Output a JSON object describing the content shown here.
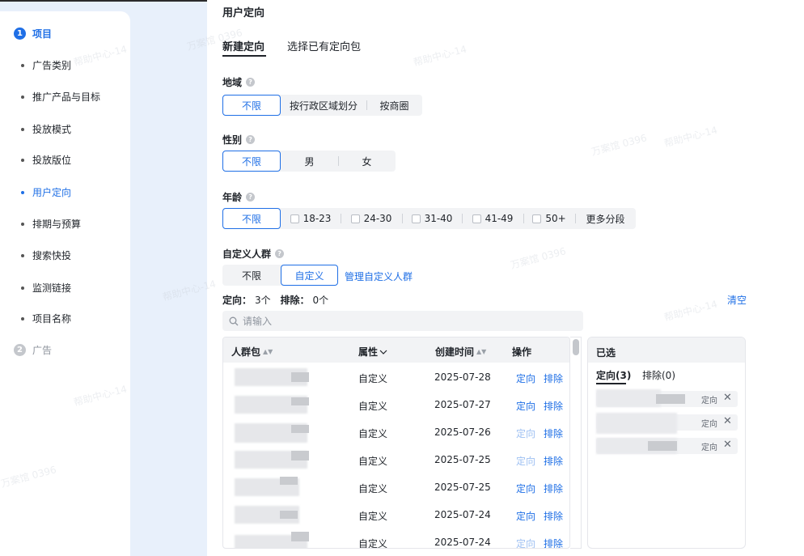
{
  "sidebar": {
    "steps": [
      {
        "num": "1",
        "label": "项目",
        "color": "#1f6fe6"
      },
      {
        "num": "2",
        "label": "广告",
        "color": "#c4c7cc"
      }
    ],
    "items": [
      {
        "label": "广告类别"
      },
      {
        "label": "推广产品与目标"
      },
      {
        "label": "投放模式"
      },
      {
        "label": "投放版位"
      },
      {
        "label": "用户定向"
      },
      {
        "label": "排期与预算"
      },
      {
        "label": "搜索快投"
      },
      {
        "label": "监测链接"
      },
      {
        "label": "项目名称"
      }
    ],
    "active_item": "用户定向"
  },
  "header": {
    "title": "用户定向",
    "tabs": [
      {
        "label": "新建定向"
      },
      {
        "label": "选择已有定向包"
      }
    ]
  },
  "region": {
    "label": "地域",
    "options": [
      "不限",
      "按行政区域划分",
      "按商圈"
    ],
    "selected": "不限"
  },
  "gender": {
    "label": "性别",
    "options": [
      "不限",
      "男",
      "女"
    ],
    "selected": "不限"
  },
  "age": {
    "label": "年龄",
    "options": [
      "不限",
      "18-23",
      "24-30",
      "31-40",
      "41-49",
      "50+"
    ],
    "selected": "不限",
    "more_label": "更多分段"
  },
  "custom_audience": {
    "label": "自定义人群",
    "options": [
      "不限",
      "自定义"
    ],
    "selected": "自定义",
    "manage_link": "管理自定义人群",
    "target_label": "定向：",
    "target_count": "3个",
    "exclude_label": "排除：",
    "exclude_count": "0个",
    "clear_label": "清空",
    "search_placeholder": "请输入",
    "table": {
      "headers": {
        "name": "人群包",
        "attr": "属性",
        "created": "创建时间",
        "ops": "操作"
      },
      "rows": [
        {
          "attr": "自定义",
          "created": "2025-07-28",
          "target": "定向",
          "exclude": "排除",
          "target_dim": false
        },
        {
          "attr": "自定义",
          "created": "2025-07-27",
          "target": "定向",
          "exclude": "排除",
          "target_dim": false
        },
        {
          "attr": "自定义",
          "created": "2025-07-26",
          "target": "定向",
          "exclude": "排除",
          "target_dim": true
        },
        {
          "attr": "自定义",
          "created": "2025-07-25",
          "target": "定向",
          "exclude": "排除",
          "target_dim": true
        },
        {
          "attr": "自定义",
          "created": "2025-07-25",
          "target": "定向",
          "exclude": "排除",
          "target_dim": false
        },
        {
          "attr": "自定义",
          "created": "2025-07-24",
          "target": "定向",
          "exclude": "排除",
          "target_dim": false
        },
        {
          "attr": "自定义",
          "created": "2025-07-24",
          "target": "定向",
          "exclude": "排除",
          "target_dim": true
        }
      ]
    },
    "selected_panel": {
      "title": "已选",
      "tabs": [
        {
          "label": "定向(3)"
        },
        {
          "label": "排除(0)"
        }
      ],
      "items": [
        {
          "tag": "定向"
        },
        {
          "tag": "定向"
        },
        {
          "tag": "定向"
        }
      ]
    }
  },
  "watermark": {
    "texts": [
      "帮助中心-14",
      "万案馆 0396"
    ]
  },
  "colors": {
    "accent": "#1f6fe6",
    "background": "#e8f0fb"
  }
}
